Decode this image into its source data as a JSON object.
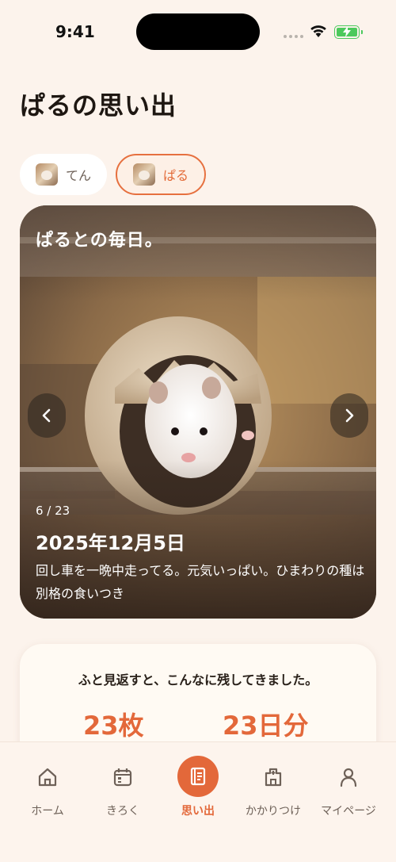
{
  "status_bar": {
    "time": "9:41"
  },
  "page": {
    "title": "ぱるの思い出"
  },
  "pets": [
    {
      "name": "てん",
      "selected": false
    },
    {
      "name": "ぱる",
      "selected": true
    }
  ],
  "photo_card": {
    "title": "ぱるとの毎日。",
    "counter": "6 / 23",
    "date": "2025年12月5日",
    "caption": "回し車を一晩中走ってる。元気いっぱい。ひまわりの種は別格の食いつき"
  },
  "summary": {
    "text": "ふと見返すと、こんなに残してきました。",
    "photos_count": "23枚",
    "days_count": "23日分"
  },
  "tabs": [
    {
      "label": "ホーム",
      "icon": "home-icon",
      "active": false
    },
    {
      "label": "きろく",
      "icon": "calendar-icon",
      "active": false
    },
    {
      "label": "思い出",
      "icon": "album-icon",
      "active": true
    },
    {
      "label": "かかりつけ",
      "icon": "hospital-icon",
      "active": false
    },
    {
      "label": "マイページ",
      "icon": "user-icon",
      "active": false
    }
  ],
  "colors": {
    "accent": "#e3683a",
    "background": "#fcf3ec",
    "card": "#fffaf3"
  }
}
